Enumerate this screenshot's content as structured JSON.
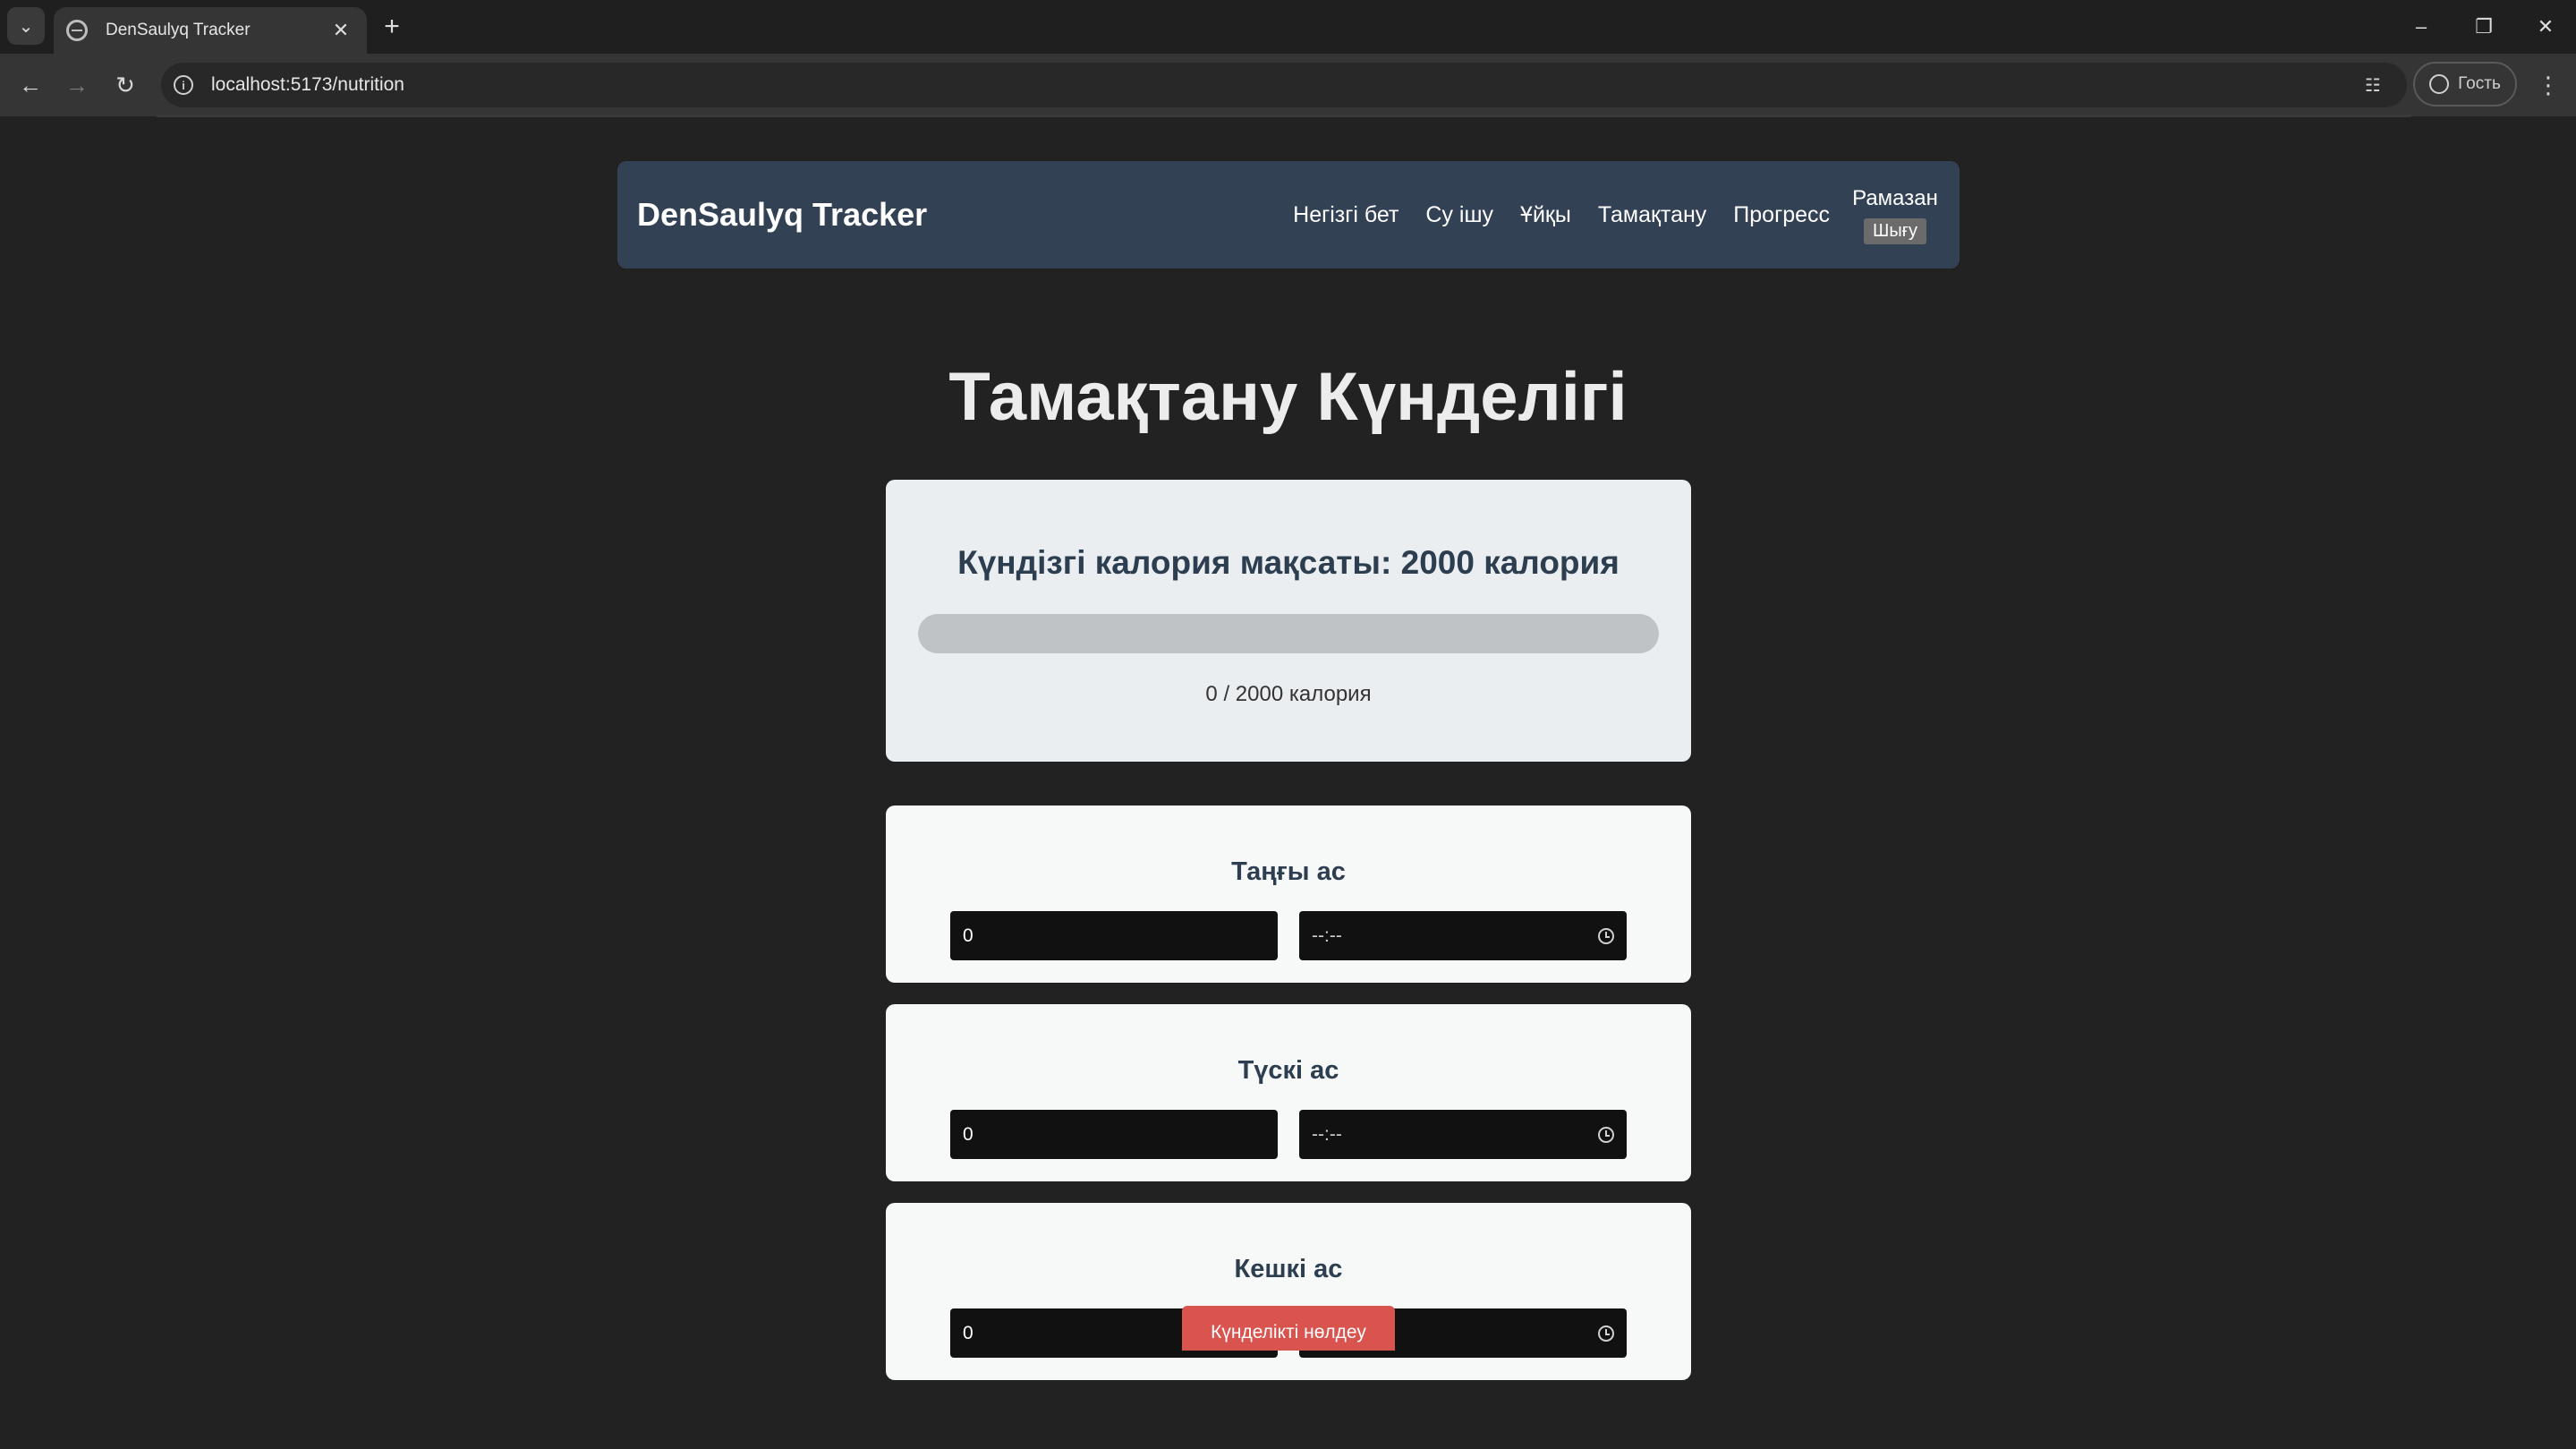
{
  "browser": {
    "tab_title": "DenSaulyq Tracker",
    "url": "localhost:5173/nutrition",
    "profile_label": "Гость"
  },
  "navbar": {
    "brand": "DenSaulyq Tracker",
    "links": [
      "Негізгі бет",
      "Су ішу",
      "Ұйқы",
      "Тамақтану",
      "Прогресс"
    ],
    "user": "Рамазан",
    "logout": "Шығу"
  },
  "page": {
    "title": "Тамақтану Күнделігі"
  },
  "goal": {
    "heading": "Күндізгі калория мақсаты: 2000 калория",
    "progress_fraction": 0,
    "count_text": "0 / 2000 калория"
  },
  "meals": [
    {
      "title": "Таңғы ас",
      "calories": "0",
      "time": "--:--"
    },
    {
      "title": "Түскі ас",
      "calories": "0",
      "time": "--:--"
    },
    {
      "title": "Кешкі ас",
      "calories": "0",
      "time": "--:--"
    }
  ],
  "actions": {
    "clear_label": "Күнделікті нөлдеу"
  },
  "colors": {
    "navbar_bg": "#334155",
    "clear_button": "#d9534f",
    "page_bg": "#222222"
  }
}
